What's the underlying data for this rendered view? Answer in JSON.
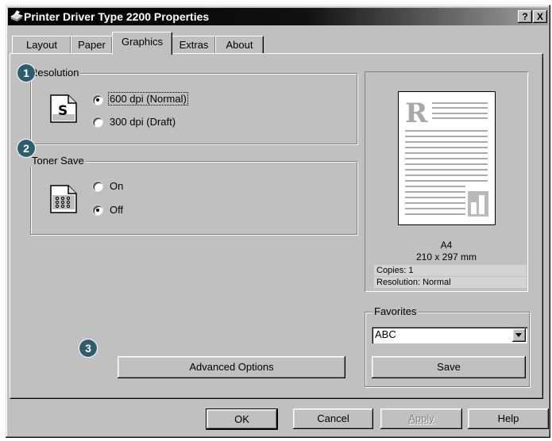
{
  "window": {
    "title": "Printer Driver Type 2200 Properties"
  },
  "titlebar_buttons": {
    "help": "?",
    "close": "X"
  },
  "tabs": [
    {
      "label": "Layout"
    },
    {
      "label": "Paper"
    },
    {
      "label": "Graphics"
    },
    {
      "label": "Extras"
    },
    {
      "label": "About"
    }
  ],
  "active_tab": "Graphics",
  "resolution": {
    "badge": "1",
    "legend": "Resolution",
    "options": [
      {
        "label": "600 dpi (Normal)",
        "selected": true
      },
      {
        "label": "300 dpi (Draft)",
        "selected": false
      }
    ],
    "icon": "printer-s-icon"
  },
  "toner_save": {
    "badge": "2",
    "legend": "Toner Save",
    "options": [
      {
        "label": "On",
        "selected": false
      },
      {
        "label": "Off",
        "selected": true
      }
    ],
    "icon": "toner-dots-icon"
  },
  "advanced": {
    "badge": "3",
    "label": "Advanced Options"
  },
  "preview": {
    "page_letter": "R",
    "paper_name": "A4",
    "paper_size": "210 x 297 mm",
    "copies": "Copies: 1",
    "resolution": "Resolution: Normal"
  },
  "favorites": {
    "legend": "Favorites",
    "selected": "ABC",
    "save_label": "Save"
  },
  "footer": {
    "ok": "OK",
    "cancel": "Cancel",
    "apply": "Apply",
    "help": "Help"
  },
  "colors": {
    "badge": "#2e5d6e",
    "face": "#c0c0c0",
    "titlebar": "#000000"
  }
}
